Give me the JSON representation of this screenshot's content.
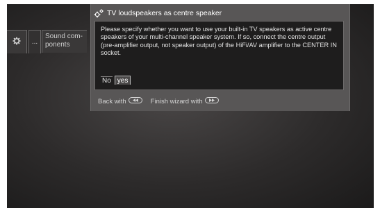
{
  "menu": {
    "dots_label": "...",
    "sound_label": "Sound com-\nponents"
  },
  "dialog": {
    "title": "TV loudspeakers as centre speaker",
    "message": "Please specify whether you want to use your built-in TV speakers as active centre speakers of your multi-channel speaker system. If so, connect the centre output (pre-amplifier output, not speaker output) of the HiFi/AV amplifier to the CENTER IN socket.",
    "options": [
      "No",
      "yes"
    ],
    "selected_option": "yes",
    "footer": {
      "back_label": "Back with",
      "back_key_icon": "rewind-key-icon",
      "finish_label": "Finish wizard with",
      "finish_key_icon": "fast-forward-key-icon"
    }
  },
  "colors": {
    "screen_bg": "#2d2b2b",
    "dialog_bg": "#585656",
    "body_bg": "#1e1d1d",
    "text": "#e3e3e3"
  }
}
